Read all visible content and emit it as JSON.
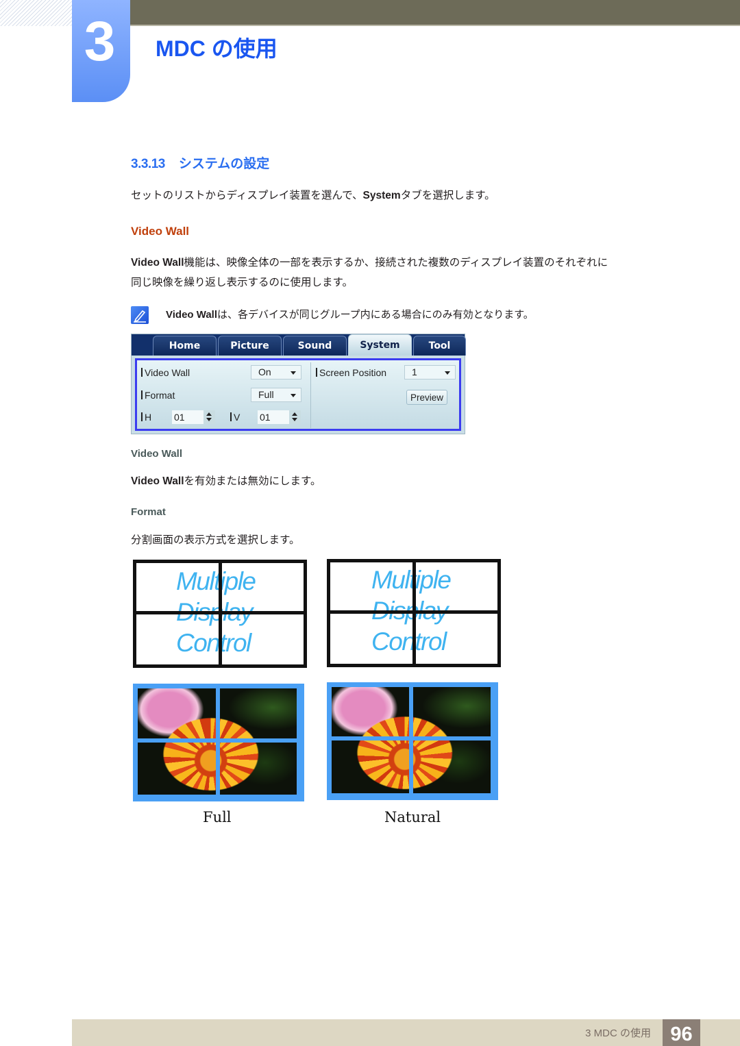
{
  "header": {
    "chapter_number": "3",
    "chapter_title": "MDC の使用"
  },
  "section": {
    "number": "3.3.13",
    "title": "システムの設定",
    "intro_prefix": "セットのリストからディスプレイ装置を選んで、",
    "intro_bold": "System",
    "intro_suffix": "タブを選択します。"
  },
  "video_wall_heading": "Video Wall",
  "video_wall_desc": {
    "bold": "Video Wall",
    "line1": "機能は、映像全体の一部を表示するか、接続された複数のディスプレイ装置のそれぞれに",
    "line2": "同じ映像を繰り返し表示するのに使用します。"
  },
  "note": {
    "icon": "note-pen-icon",
    "bold": "Video Wall",
    "text": "は、各デバイスが同じグループ内にある場合にのみ有効となります。"
  },
  "mdc_panel": {
    "tabs": [
      {
        "label": "Home",
        "active": false
      },
      {
        "label": "Picture",
        "active": false
      },
      {
        "label": "Sound",
        "active": false
      },
      {
        "label": "System",
        "active": true
      },
      {
        "label": "Tool",
        "active": false
      }
    ],
    "video_wall_label": "Video Wall",
    "video_wall_value": "On",
    "format_label": "Format",
    "format_value": "Full",
    "h_label": "H",
    "h_value": "01",
    "v_label": "V",
    "v_value": "01",
    "screen_position_label": "Screen Position",
    "screen_position_value": "1",
    "preview_label": "Preview"
  },
  "items": [
    {
      "heading": "Video Wall",
      "desc_bold": "Video Wall",
      "desc": "を有効または無効にします。"
    },
    {
      "heading": "Format",
      "desc": "分割画面の表示方式を選択します。"
    }
  ],
  "diagram_text": [
    "Multiple",
    "Display",
    "Control"
  ],
  "captions": {
    "full": "Full",
    "natural": "Natural"
  },
  "footer": {
    "chapter": "3 MDC の使用",
    "page": "96"
  }
}
